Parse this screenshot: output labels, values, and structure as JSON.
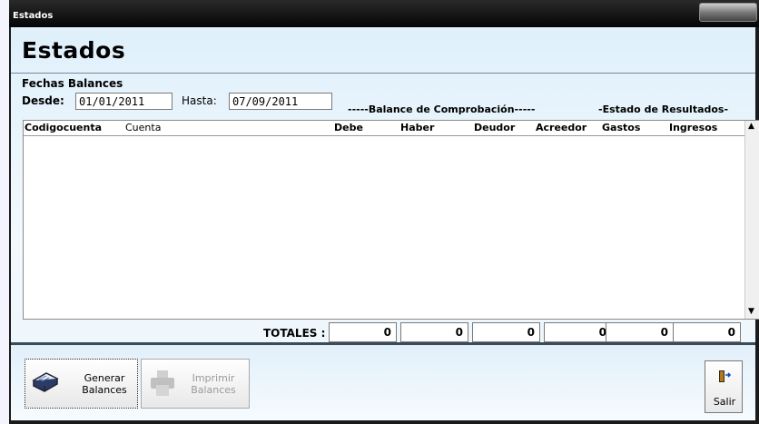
{
  "window": {
    "title": "Estados"
  },
  "heading": "Estados",
  "fechas": {
    "group_label": "Fechas Balances",
    "desde_label": "Desde:",
    "desde_value": "01/01/2011",
    "hasta_label": "Hasta:",
    "hasta_value": "07/09/2011"
  },
  "section_labels": {
    "balance": "-----Balance de Comprobación-----",
    "resultados": "-Estado de Resultados-"
  },
  "grid": {
    "columns": [
      "Codigocuenta",
      "Cuenta",
      "Debe",
      "Haber",
      "Deudor",
      "Acreedor",
      "Gastos",
      "Ingresos"
    ],
    "rows": []
  },
  "totals": {
    "label": "TOTALES :",
    "values": [
      "0",
      "0",
      "0",
      "0",
      "0",
      "0"
    ]
  },
  "buttons": {
    "generar": "Generar\nBalances",
    "imprimir": "Imprimir\nBalances",
    "salir": "Salir"
  },
  "icons": {
    "generar": "book-icon",
    "imprimir": "printer-icon",
    "salir": "exit-door-icon"
  },
  "colors": {
    "client_bg": "#dff0fb",
    "titlebar": "#050505",
    "disabled_text": "#9a9a9a"
  }
}
